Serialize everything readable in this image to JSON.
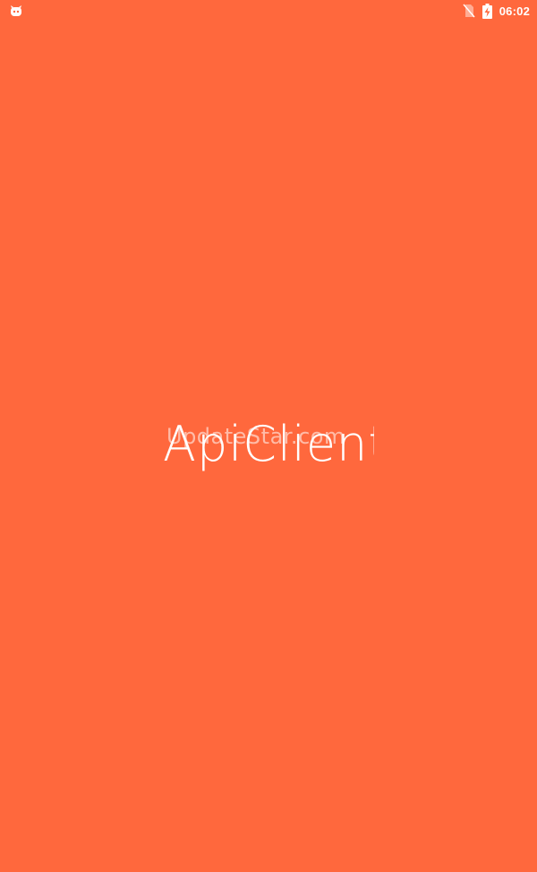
{
  "status_bar": {
    "time": "06:02",
    "left_icon": "android-debug-icon",
    "no_sim_icon": "no-sim-icon",
    "battery_icon": "battery-charging-icon"
  },
  "splash": {
    "background_color": "#FF683D",
    "logo_text": "ApiClient",
    "watermark_text": "UpdateStar.com"
  }
}
